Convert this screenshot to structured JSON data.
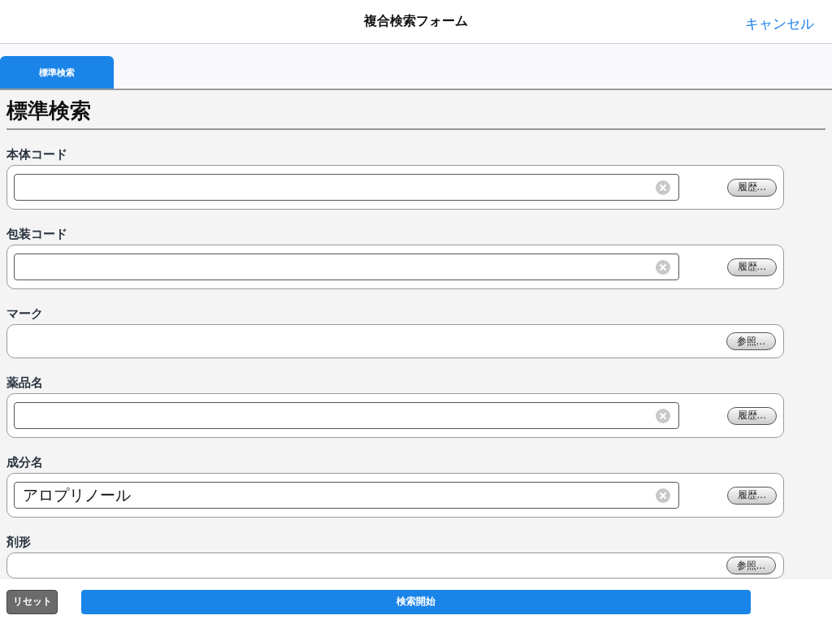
{
  "header": {
    "title": "複合検索フォーム",
    "cancel": "キャンセル"
  },
  "tabs": [
    {
      "label": "標準検索",
      "selected": true
    }
  ],
  "section_title": "標準検索",
  "fields": [
    {
      "kind": "text",
      "label": "本体コード",
      "button": "履歴..."
    },
    {
      "kind": "text",
      "label": "包装コード",
      "button": "履歴..."
    },
    {
      "kind": "reference",
      "label": "マーク",
      "button": "参照..."
    },
    {
      "kind": "text",
      "label": "薬品名",
      "button": "履歴..."
    },
    {
      "kind": "text",
      "label": "成分名",
      "value": "アロプリノール",
      "button": "履歴..."
    },
    {
      "kind": "reference",
      "label": "剤形",
      "button": "参照..."
    }
  ],
  "footer": {
    "reset": "リセット",
    "search": "検索開始"
  }
}
